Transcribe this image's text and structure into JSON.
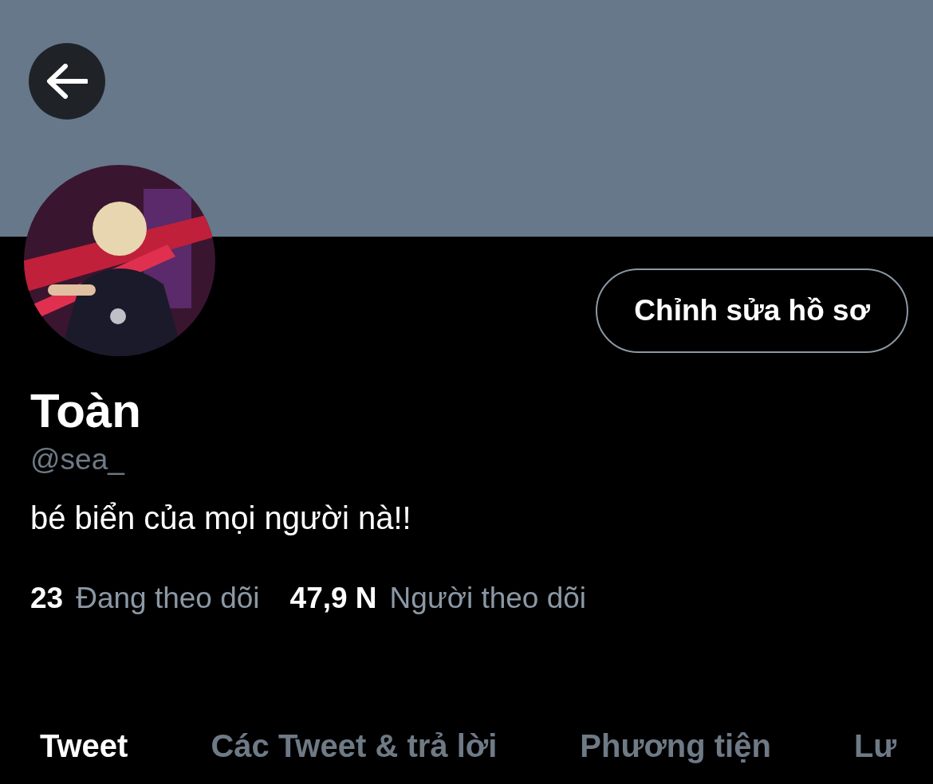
{
  "profile": {
    "edit_button": "Chỉnh sửa hồ sơ",
    "name": "Toàn",
    "handle": "@sea_",
    "bio": "bé biển của mọi người nà!!",
    "stats": [
      {
        "count": "23",
        "label": "Đang theo dõi"
      },
      {
        "count": "47,9 N",
        "label": "Người theo dõi"
      }
    ]
  },
  "tabs": [
    {
      "label": "Tweet",
      "selected": true
    },
    {
      "label": "Các Tweet & trả lời",
      "selected": false
    },
    {
      "label": "Phương tiện",
      "selected": false
    },
    {
      "label": "Lư",
      "selected": false
    }
  ]
}
